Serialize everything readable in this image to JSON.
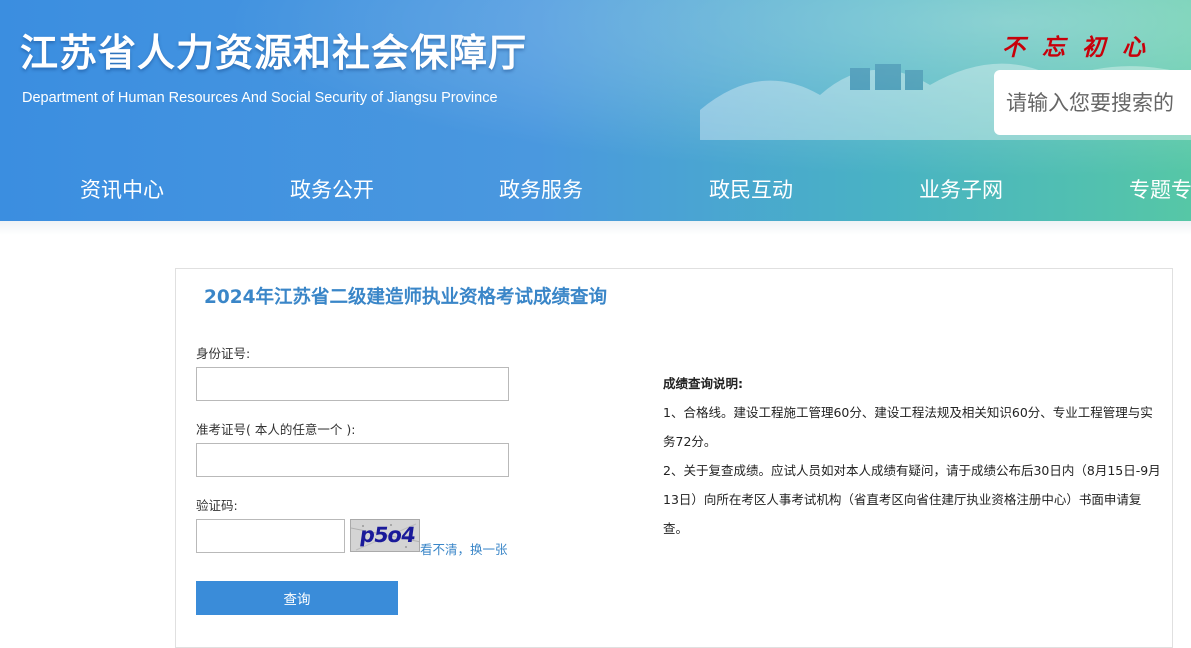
{
  "header": {
    "title": "江苏省人力资源和社会保障厅",
    "subtitle": "Department of Human Resources And Social Security of Jiangsu Province",
    "slogan": "不忘初心",
    "search_placeholder": "请输入您要搜索的",
    "accent_color": "#3b8ee0"
  },
  "nav": {
    "items": [
      {
        "label": "资讯中心"
      },
      {
        "label": "政务公开"
      },
      {
        "label": "政务服务"
      },
      {
        "label": "政民互动"
      },
      {
        "label": "业务子网"
      },
      {
        "label": "专题专"
      }
    ]
  },
  "form": {
    "title": "2024年江苏省二级建造师执业资格考试成绩查询",
    "id_label": "身份证号:",
    "ticket_label": "准考证号( 本人的任意一个 ):",
    "captcha_label": "验证码:",
    "captcha_text": "p5o4",
    "refresh_text": "看不清，换一张",
    "submit_label": "查询",
    "link_color": "#3a86c8",
    "button_color": "#3a8cd9"
  },
  "notes": {
    "title": "成绩查询说明:",
    "item1": "1、合格线。建设工程施工管理60分、建设工程法规及相关知识60分、专业工程管理与实务72分。",
    "item2": "2、关于复查成绩。应试人员如对本人成绩有疑问，请于成绩公布后30日内（8月15日-9月13日）向所在考区人事考试机构（省直考区向省住建厅执业资格注册中心）书面申请复查。"
  }
}
